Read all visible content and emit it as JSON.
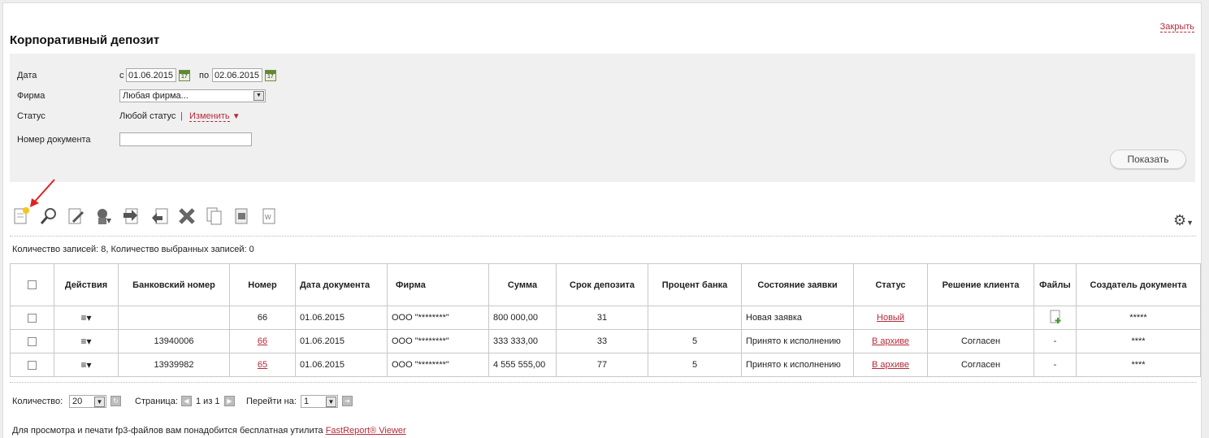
{
  "header": {
    "title": "Корпоративный депозит",
    "close_label": "Закрыть"
  },
  "filter": {
    "date_label": "Дата",
    "date_from_prefix": "с",
    "date_from": "01.06.2015",
    "date_to_prefix": "по",
    "date_to": "02.06.2015",
    "calendar_num": "17",
    "firm_label": "Фирма",
    "firm_value": "Любая фирма...",
    "status_label": "Статус",
    "status_value": "Любой статус",
    "status_sep": "|",
    "status_change": "Изменить",
    "status_arrow": "▼",
    "docnum_label": "Номер документа",
    "docnum_value": "",
    "show_button": "Показать"
  },
  "records_info": "Количество записей: 8, Количество выбранных записей: 0",
  "toolbar": {
    "icons": [
      "new-document-icon",
      "search-icon",
      "edit-icon",
      "sign-icon",
      "send-icon",
      "return-icon",
      "delete-icon",
      "copy-icon",
      "print-icon",
      "export-word-icon"
    ],
    "settings_icon": "gear-icon"
  },
  "table": {
    "columns": [
      "Действия",
      "Банковский номер",
      "Номер",
      "Дата документа",
      "Фирма",
      "Сумма",
      "Срок депозита",
      "Процент банка",
      "Состояние заявки",
      "Статус",
      "Решение клиента",
      "Файлы",
      "Создатель документа"
    ],
    "rows": [
      {
        "bank_number": "",
        "number": "66",
        "date": "01.06.2015",
        "firm": "ООО \"********\"",
        "sum": "800 000,00",
        "term": "31",
        "percent": "",
        "state": "Новая заявка",
        "status": "Новый",
        "decision": "",
        "files": "",
        "creator": "*****"
      },
      {
        "bank_number": "13940006",
        "number": "66",
        "date": "01.06.2015",
        "firm": "ООО \"********\"",
        "sum": "333 333,00",
        "term": "33",
        "percent": "5",
        "state": "Принято к исполнению",
        "status": "В архиве",
        "decision": "Согласен",
        "files": "-",
        "creator": "****"
      },
      {
        "bank_number": "13939982",
        "number": "65",
        "date": "01.06.2015",
        "firm": "ООО \"********\"",
        "sum": "4 555 555,00",
        "term": "77",
        "percent": "5",
        "state": "Принято к исполнению",
        "status": "В архиве",
        "decision": "Согласен",
        "files": "-",
        "creator": "****"
      }
    ]
  },
  "pager": {
    "count_label": "Количество:",
    "count_value": "20",
    "page_label": "Страница:",
    "page_info": "1 из 1",
    "goto_label": "Перейти на:",
    "goto_value": "1"
  },
  "footer": {
    "text": "Для просмотра и печати fp3-файлов вам понадобится бесплатная утилита",
    "link": "FastReport® Viewer"
  },
  "colors": {
    "accent": "#b52a3a",
    "filter_bg": "#f0f0f0"
  }
}
